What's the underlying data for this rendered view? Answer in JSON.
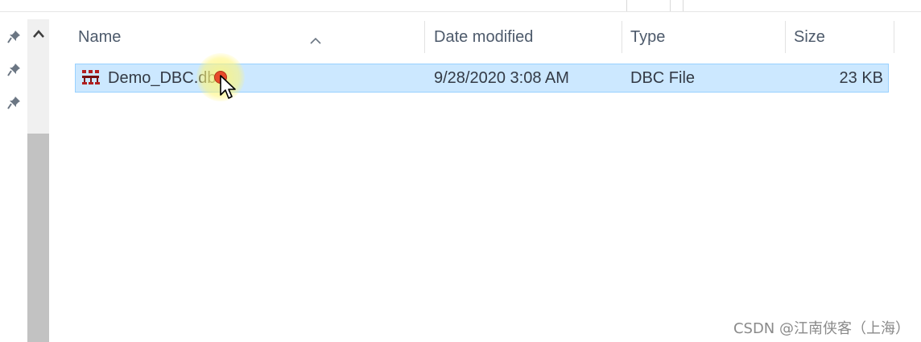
{
  "columns": {
    "name": "Name",
    "date_modified": "Date modified",
    "type": "Type",
    "size": "Size"
  },
  "sort": {
    "column": "name",
    "direction": "ascending"
  },
  "files": [
    {
      "name": "Demo_DBC.dbc",
      "date_modified": "9/28/2020 3:08 AM",
      "type": "DBC File",
      "size": "23 KB",
      "selected": true,
      "icon": "dbc-file-icon"
    }
  ],
  "quick_access_pins": [
    "pin-icon",
    "pin-icon",
    "pin-icon"
  ],
  "watermark": "CSDN @江南侠客（上海）",
  "colors": {
    "selection_bg": "#cce8ff",
    "selection_border": "#99d1ff",
    "header_text": "#4d5a6b",
    "row_text": "#333a45",
    "scrollbar_track": "#f0f0f0",
    "scrollbar_thumb": "#c2c2c2"
  }
}
